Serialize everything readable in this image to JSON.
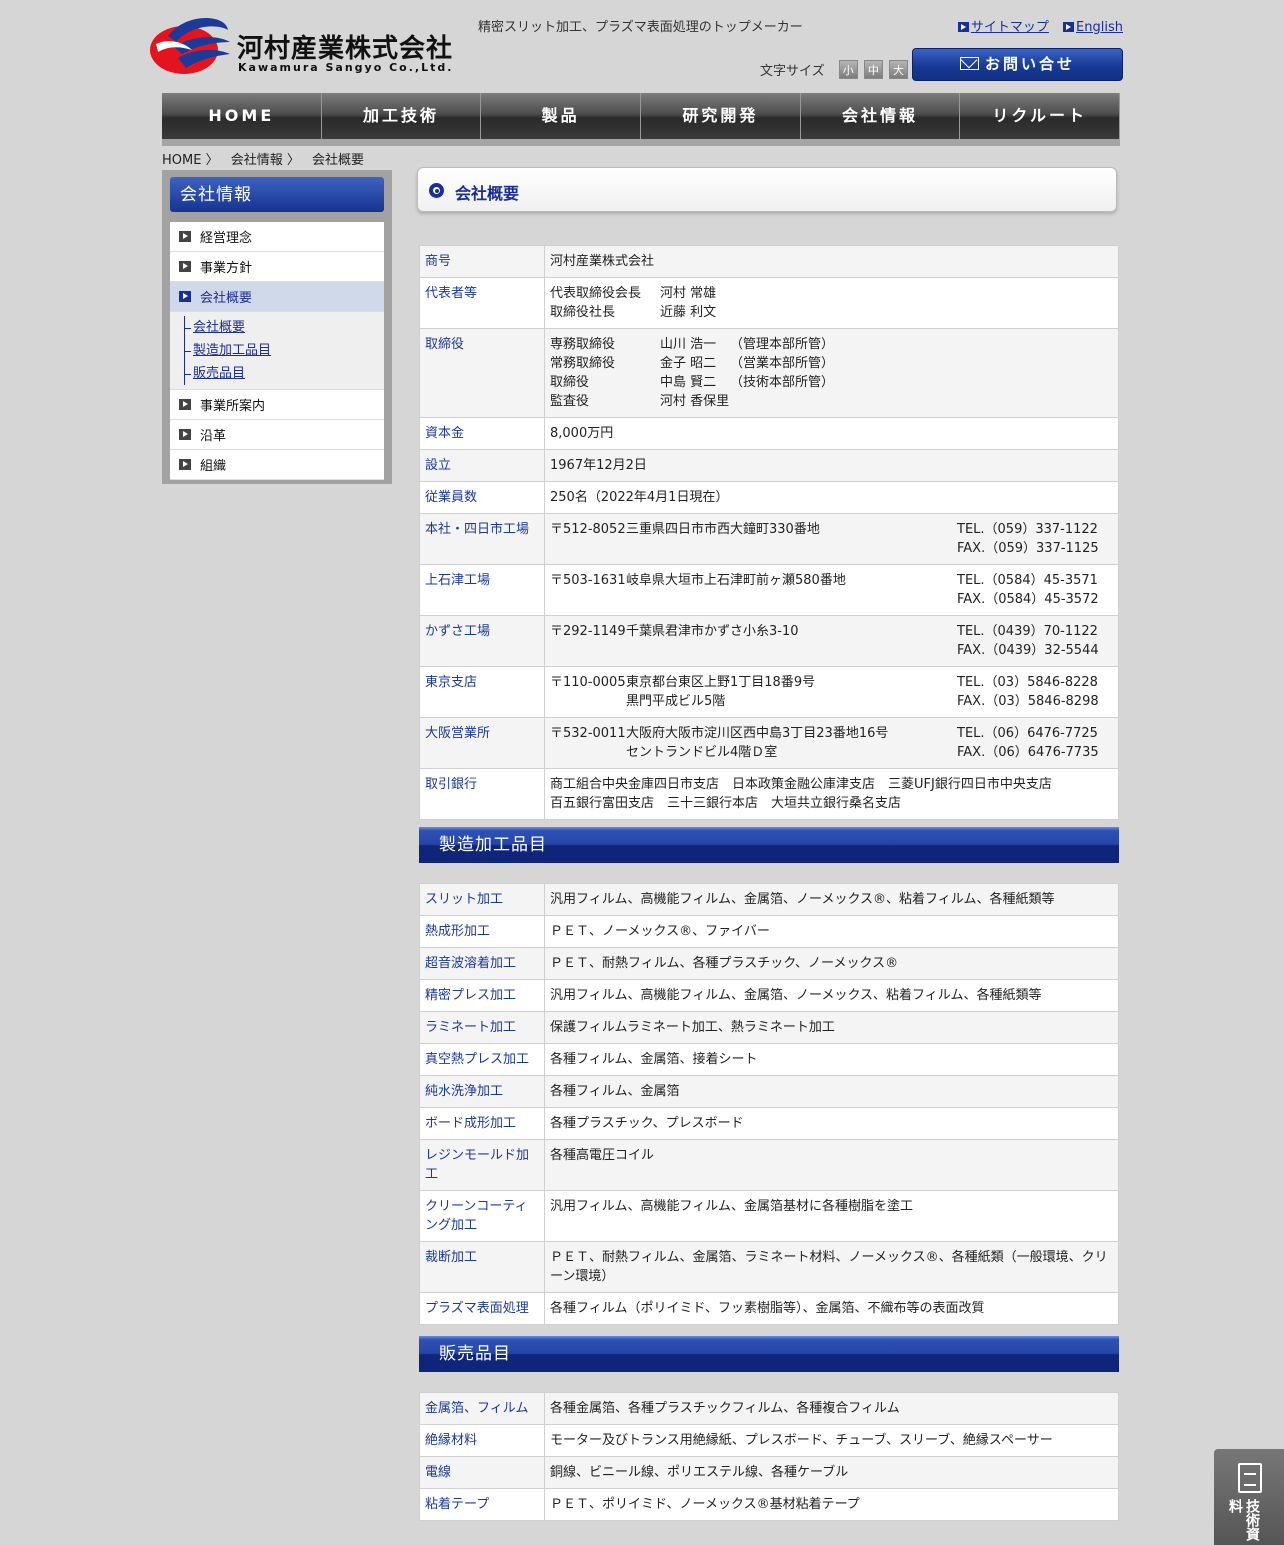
{
  "header": {
    "logo_jp": "河村産業株式会社",
    "logo_en": "Kawamura Sangyo Co.,Ltd.",
    "tagline": "精密スリット加工、プラズマ表面処理のトップメーカー",
    "links": {
      "sitemap": "サイトマップ",
      "english": "English"
    },
    "font_size": {
      "label": "文字サイズ",
      "small": "小",
      "medium": "中",
      "large": "大"
    },
    "contact": "お問い合せ"
  },
  "nav": [
    "HOME",
    "加工技術",
    "製品",
    "研究開発",
    "会社情報",
    "リクルート"
  ],
  "breadcrumb": [
    "HOME 〉",
    "会社情報 〉",
    "会社概要"
  ],
  "sidebar": {
    "title": "会社情報",
    "items": [
      {
        "label": "経営理念"
      },
      {
        "label": "事業方針"
      },
      {
        "label": "会社概要"
      },
      {
        "label": "事業所案内"
      },
      {
        "label": "沿革"
      },
      {
        "label": "組織"
      }
    ],
    "subitems": [
      "会社概要",
      "製造加工品目",
      "販売品目"
    ]
  },
  "heading": "会社概要",
  "overview": {
    "trade_name": {
      "label": "商号",
      "value": "河村産業株式会社"
    },
    "representative": {
      "label": "代表者等",
      "rows": [
        [
          "代表取締役会長",
          "河村 常雄"
        ],
        [
          "取締役社長",
          "近藤 利文"
        ]
      ]
    },
    "directors": {
      "label": "取締役",
      "rows": [
        [
          "専務取締役",
          "山川 浩一",
          "（管理本部所管）"
        ],
        [
          "常務取締役",
          "金子 昭二",
          "（営業本部所管）"
        ],
        [
          "取締役",
          "中島 賢二",
          "（技術本部所管）"
        ],
        [
          "監査役",
          "河村 香保里",
          ""
        ]
      ]
    },
    "capital": {
      "label": "資本金",
      "value": "8,000万円"
    },
    "founded": {
      "label": "設立",
      "value": "1967年12月2日"
    },
    "employees": {
      "label": "従業員数",
      "value": "250名（2022年4月1日現在）"
    },
    "offices": [
      {
        "label": "本社・四日市工場",
        "zip": "〒512-8052",
        "address": [
          "三重県四日市市西大鐘町330番地"
        ],
        "tel": "TEL.（059）337-1122",
        "fax": "FAX.（059）337-1125"
      },
      {
        "label": "上石津工場",
        "zip": "〒503-1631",
        "address": [
          "岐阜県大垣市上石津町前ヶ瀬580番地"
        ],
        "tel": "TEL.（0584）45-3571",
        "fax": "FAX.（0584）45-3572"
      },
      {
        "label": "かずさ工場",
        "zip": "〒292-1149",
        "address": [
          "千葉県君津市かずさ小糸3-10"
        ],
        "tel": "TEL.（0439）70-1122",
        "fax": "FAX.（0439）32-5544"
      },
      {
        "label": "東京支店",
        "zip": "〒110-0005",
        "address": [
          "東京都台東区上野1丁目18番9号",
          "黒門平成ビル5階"
        ],
        "tel": "TEL.（03）5846-8228",
        "fax": "FAX.（03）5846-8298"
      },
      {
        "label": "大阪営業所",
        "zip": "〒532-0011",
        "address": [
          "大阪府大阪市淀川区西中島3丁目23番地16号",
          "セントランドビル4階Ｄ室"
        ],
        "tel": "TEL.（06）6476-7725",
        "fax": "FAX.（06）6476-7735"
      }
    ],
    "banks": {
      "label": "取引銀行",
      "lines": [
        "商工組合中央金庫四日市支店　日本政策金融公庫津支店　三菱UFJ銀行四日市中央支店",
        "百五銀行富田支店　三十三銀行本店　大垣共立銀行桑名支店"
      ]
    }
  },
  "manufacturing": {
    "title": "製造加工品目",
    "rows": [
      [
        "スリット加工",
        "汎用フィルム、高機能フィルム、金属箔、ノーメックス®、粘着フィルム、各種紙類等"
      ],
      [
        "熱成形加工",
        "ＰＥＴ、ノーメックス®、ファイバー"
      ],
      [
        "超音波溶着加工",
        "ＰＥＴ、耐熱フィルム、各種プラスチック、ノーメックス®"
      ],
      [
        "精密プレス加工",
        "汎用フィルム、高機能フィルム、金属箔、ノーメックス、粘着フィルム、各種紙類等"
      ],
      [
        "ラミネート加工",
        "保護フィルムラミネート加工、熱ラミネート加工"
      ],
      [
        "真空熱プレス加工",
        "各種フィルム、金属箔、接着シート"
      ],
      [
        "純水洗浄加工",
        "各種フィルム、金属箔"
      ],
      [
        "ボード成形加工",
        "各種プラスチック、プレスボード"
      ],
      [
        "レジンモールド加工",
        "各種高電圧コイル"
      ],
      [
        "クリーンコーティング加工",
        "汎用フィルム、高機能フィルム、金属箔基材に各種樹脂を塗工"
      ],
      [
        "裁断加工",
        "ＰＥＴ、耐熱フィルム、金属箔、ラミネート材料、ノーメックス®、各種紙類（一般環境、クリーン環境）"
      ],
      [
        "プラズマ表面処理",
        "各種フィルム（ポリイミド、フッ素樹脂等）、金属箔、不織布等の表面改質"
      ]
    ]
  },
  "sales": {
    "title": "販売品目",
    "rows": [
      [
        "金属箔、フィルム",
        "各種金属箔、各種プラスチックフィルム、各種複合フィルム"
      ],
      [
        "絶縁材料",
        "モーター及びトランス用絶縁紙、プレスボード、チューブ、スリーブ、絶縁スペーサー"
      ],
      [
        "電線",
        "銅線、ビニール線、ポリエステル線、各種ケーブル"
      ],
      [
        "粘着テープ",
        "ＰＥＴ、ポリイミド、ノーメックス®基材粘着テープ"
      ]
    ]
  },
  "side_tab": "技術資料"
}
